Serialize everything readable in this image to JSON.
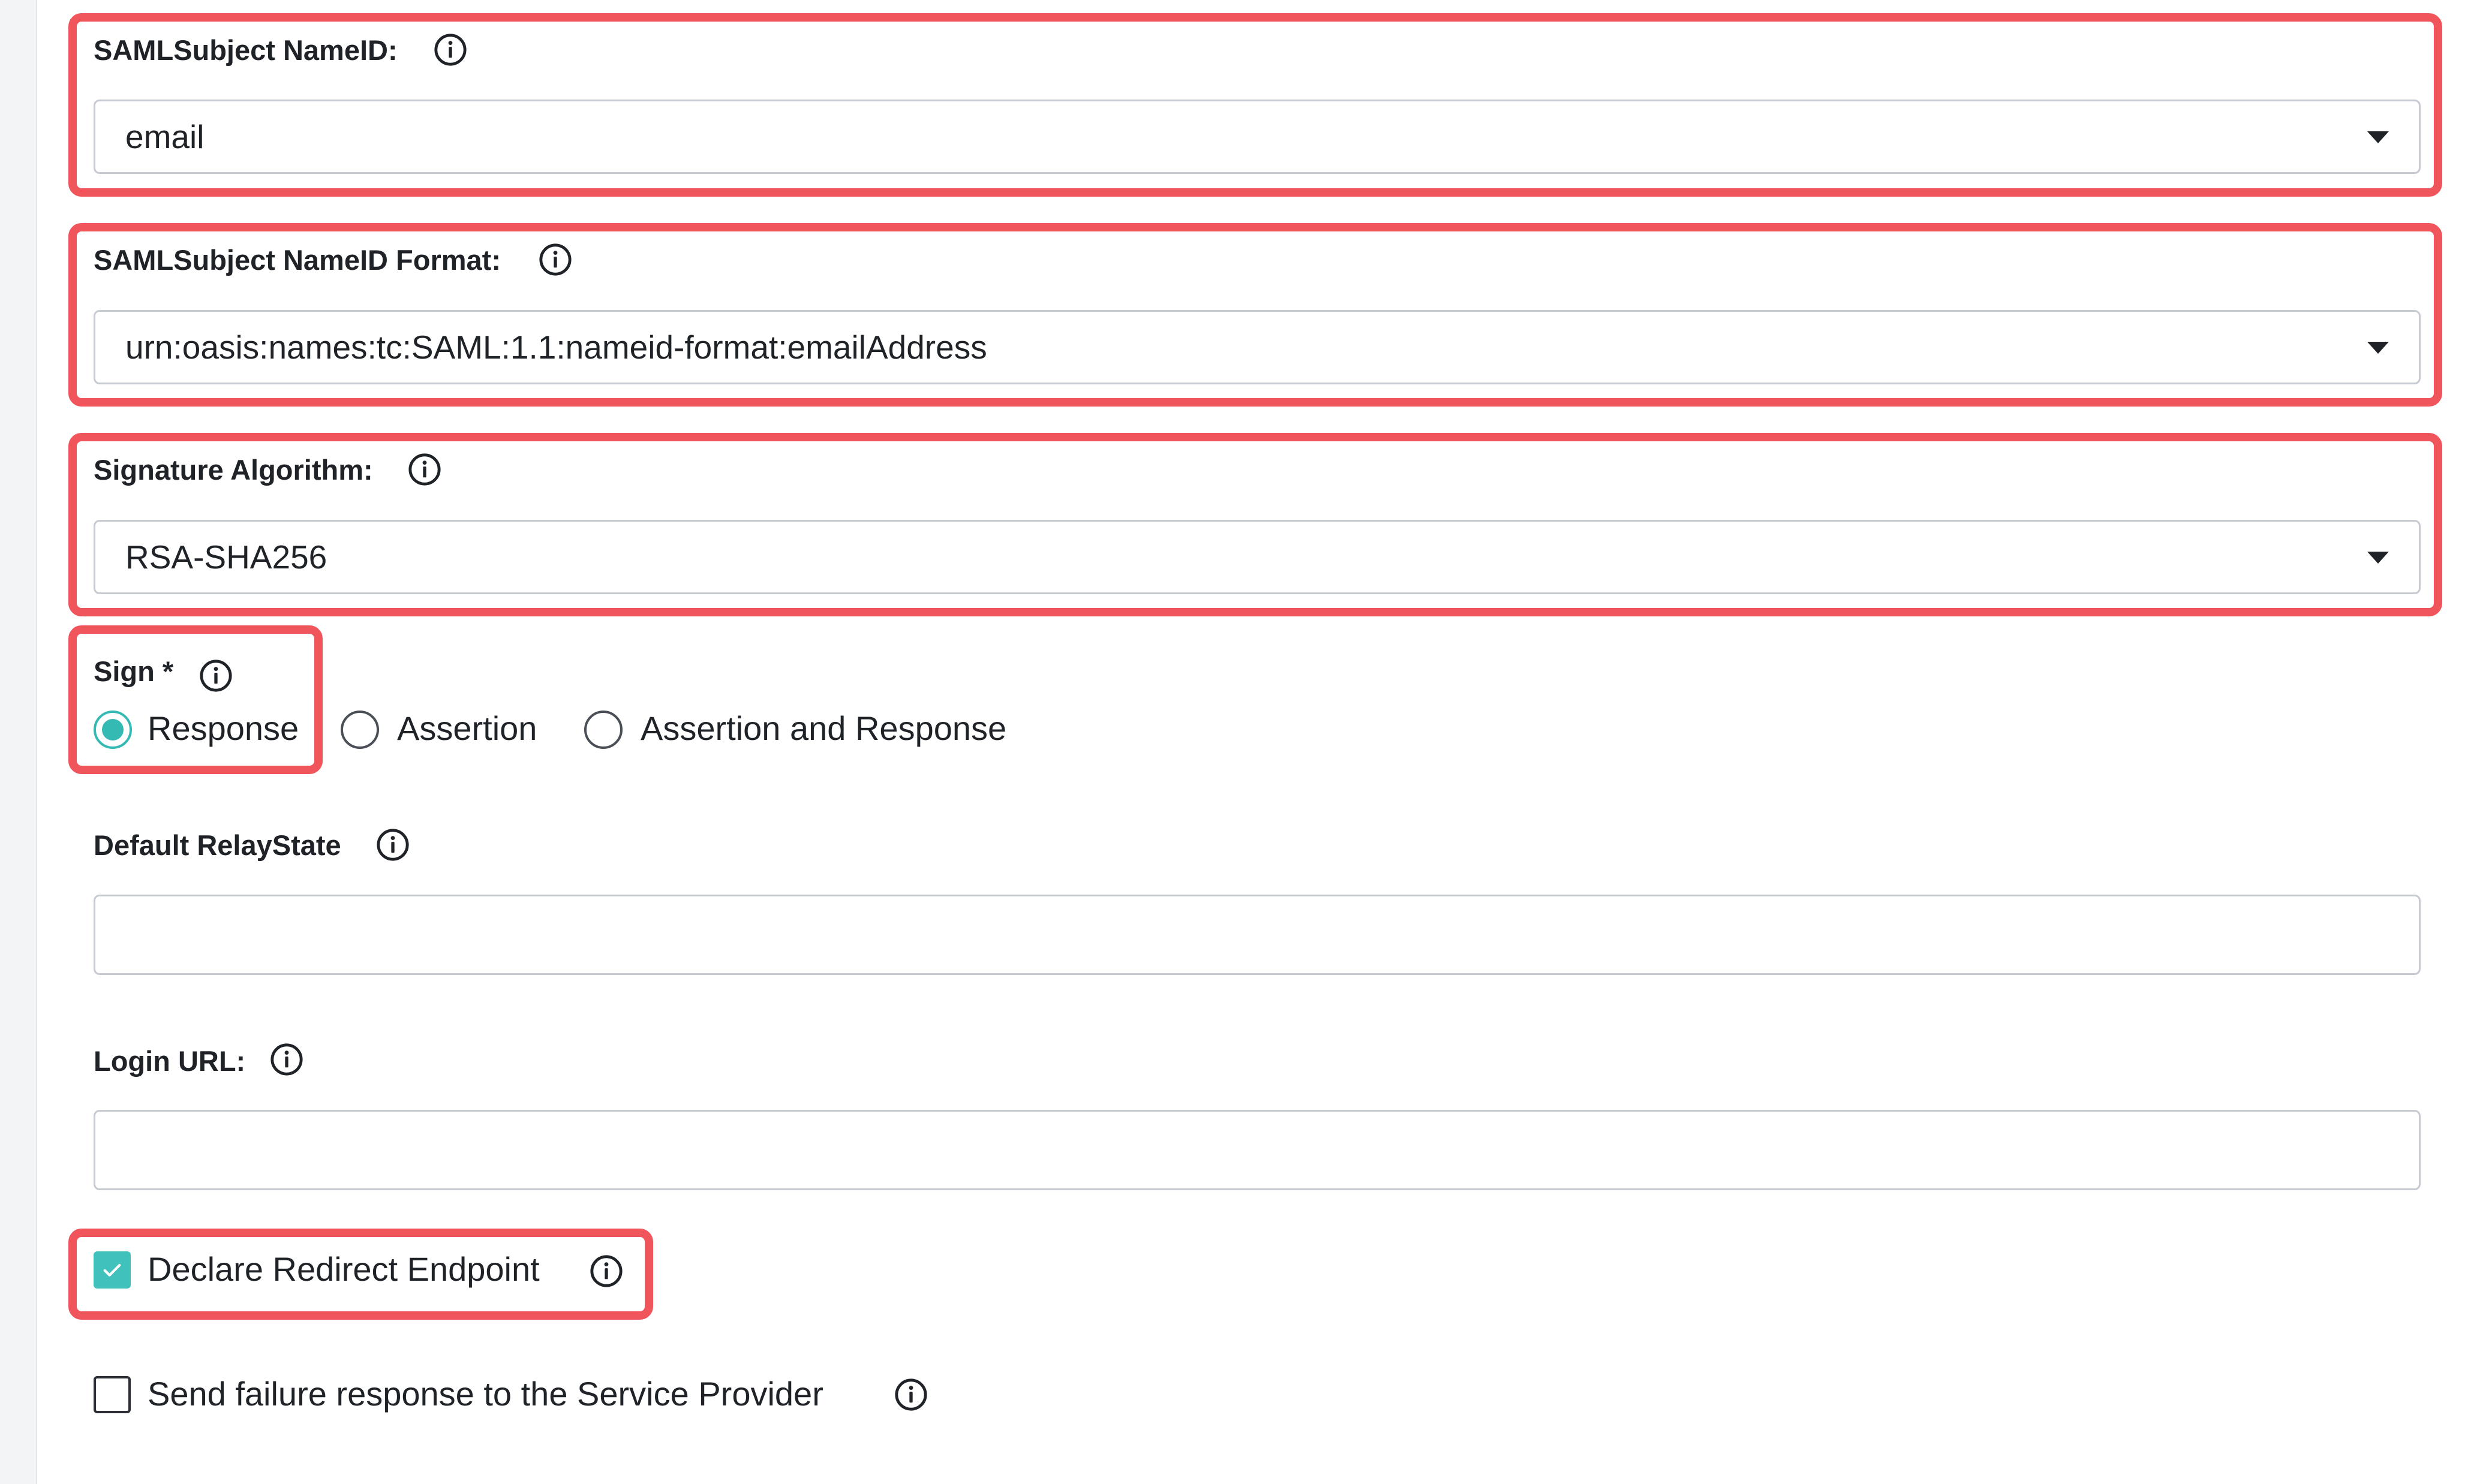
{
  "nameid": {
    "label": "SAMLSubject NameID:",
    "value": "email"
  },
  "nameid_format": {
    "label": "SAMLSubject NameID Format:",
    "value": "urn:oasis:names:tc:SAML:1.1:nameid-format:emailAddress"
  },
  "signature_algorithm": {
    "label": "Signature Algorithm:",
    "value": "RSA-SHA256"
  },
  "sign": {
    "label": "Sign *",
    "options": [
      "Response",
      "Assertion",
      "Assertion and Response"
    ],
    "selected": "Response"
  },
  "relay_state": {
    "label": "Default RelayState",
    "value": ""
  },
  "login_url": {
    "label": "Login URL:",
    "value": ""
  },
  "declare_redirect": {
    "label": "Declare Redirect Endpoint",
    "checked": true
  },
  "send_failure": {
    "label": "Send failure response to the Service Provider",
    "checked": false
  },
  "colors": {
    "highlight": "#f0555c",
    "accent": "#34b9b3",
    "border": "#c7cbd1"
  },
  "icons": {
    "info": "info-circle-icon",
    "caret": "caret-down-icon",
    "check": "check-icon"
  }
}
